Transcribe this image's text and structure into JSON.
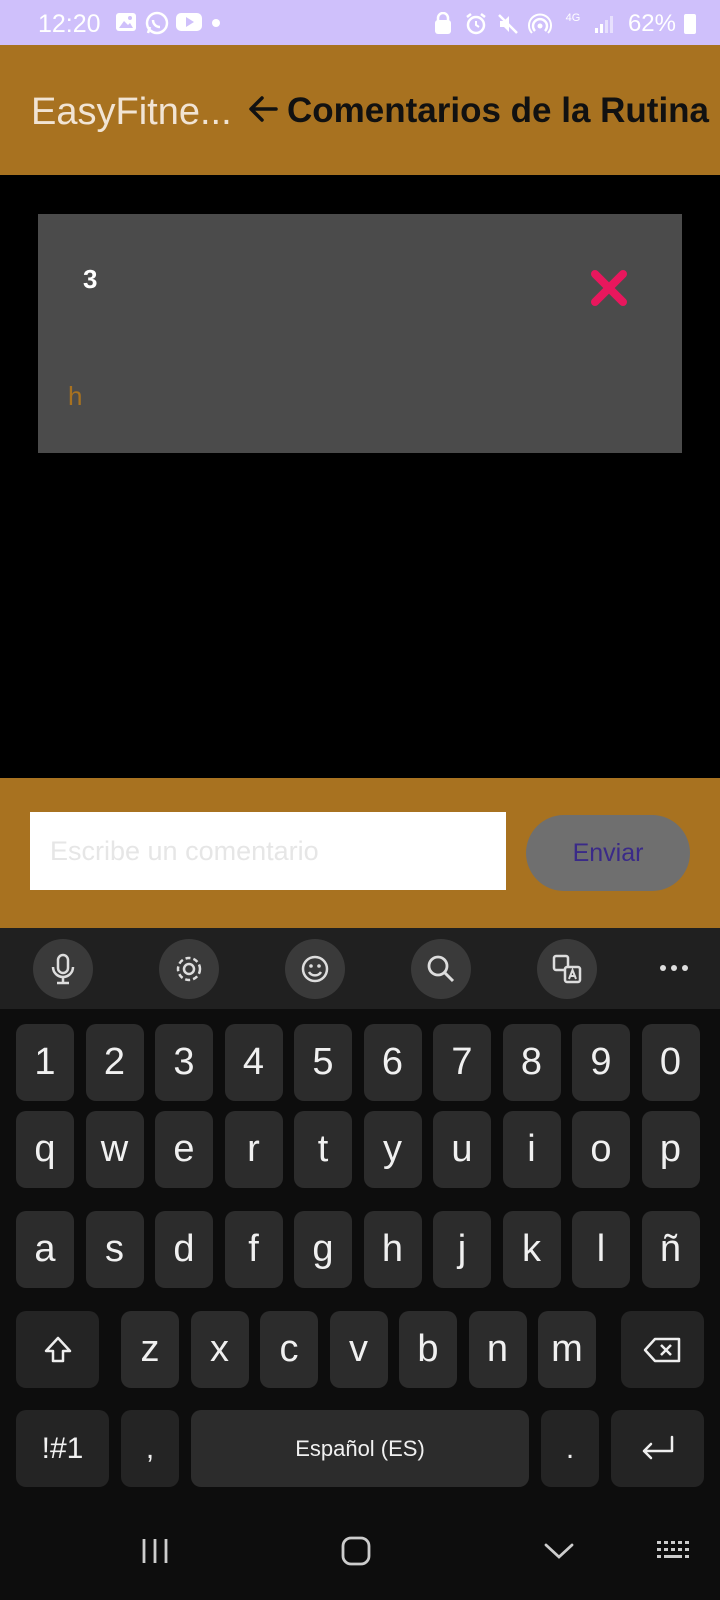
{
  "status_bar": {
    "time": "12:20",
    "battery": "62%",
    "network": "4G"
  },
  "app_bar": {
    "app_name": "EasyFitne...",
    "title": "Comentarios de la Rutina"
  },
  "comments": [
    {
      "author": "3",
      "text": "h"
    }
  ],
  "composer": {
    "placeholder": "Escribe un comentario",
    "value": "",
    "send_label": "Enviar"
  },
  "keyboard": {
    "row_numbers": [
      "1",
      "2",
      "3",
      "4",
      "5",
      "6",
      "7",
      "8",
      "9",
      "0"
    ],
    "row_1": [
      "q",
      "w",
      "e",
      "r",
      "t",
      "y",
      "u",
      "i",
      "o",
      "p"
    ],
    "row_2": [
      "a",
      "s",
      "d",
      "f",
      "g",
      "h",
      "j",
      "k",
      "l",
      "ñ"
    ],
    "row_3": [
      "z",
      "x",
      "c",
      "v",
      "b",
      "n",
      "m"
    ],
    "symbols_label": "!#1",
    "comma_label": ",",
    "space_label": "Español (ES)",
    "period_label": "."
  },
  "colors": {
    "status_bar": "#cfc0fb",
    "app_bar": "#a87220",
    "card": "#4b4b4b",
    "delete": "#e8175d",
    "send_text": "#3a2a88"
  }
}
